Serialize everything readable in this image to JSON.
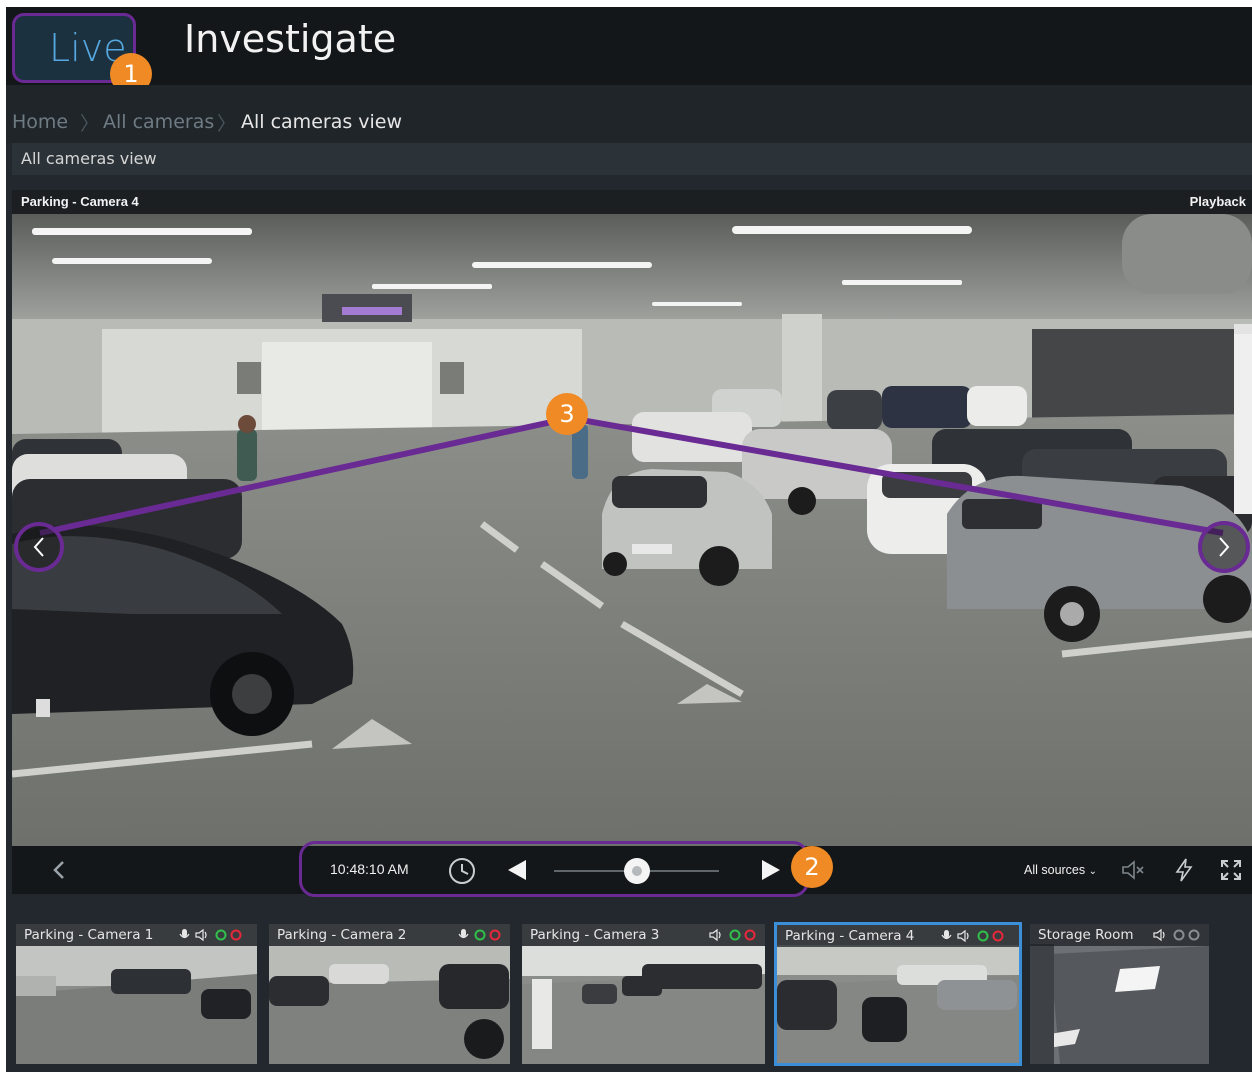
{
  "nav": {
    "live_label": "Live",
    "investigate_label": "Investigate"
  },
  "breadcrumb": {
    "home": "Home",
    "all_cameras": "All cameras",
    "current": "All cameras view"
  },
  "view": {
    "title": "All cameras view"
  },
  "main_camera": {
    "title": "Parking - Camera 4",
    "mode": "Playback"
  },
  "controls": {
    "time": "10:48:10 AM",
    "sources_label": "All sources",
    "slider_position": 0.5
  },
  "thumbnails": [
    {
      "title": "Parking - Camera 1",
      "icons": [
        "mic-icon",
        "speaker-icon",
        "green-dot",
        "red-dot"
      ]
    },
    {
      "title": "Parking - Camera 2",
      "icons": [
        "mic-icon",
        "green-dot",
        "red-dot"
      ]
    },
    {
      "title": "Parking - Camera 3",
      "icons": [
        "speaker-icon",
        "green-dot",
        "red-dot"
      ]
    },
    {
      "title": "Parking - Camera 4",
      "icons": [
        "mic-icon",
        "speaker-icon",
        "green-dot",
        "red-dot"
      ],
      "selected": true
    },
    {
      "title": "Storage Room",
      "icons": [
        "speaker-icon",
        "grey-dot",
        "grey-dot"
      ]
    }
  ],
  "callouts": [
    "1",
    "2",
    "3"
  ],
  "colors": {
    "accent": "#56a8e0",
    "callout": "#f08a24",
    "highlight": "#6a2a93",
    "selected_border": "#3b8fd9"
  }
}
